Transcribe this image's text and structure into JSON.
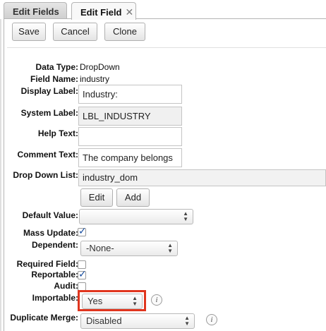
{
  "tabs": [
    {
      "label": "Edit Fields",
      "active": false
    },
    {
      "label": "Edit Field",
      "active": true,
      "close": "✕"
    }
  ],
  "toolbar": {
    "save_label": "Save",
    "cancel_label": "Cancel",
    "clone_label": "Clone"
  },
  "form": {
    "data_type": {
      "label": "Data Type:",
      "value": "DropDown"
    },
    "field_name": {
      "label": "Field Name:",
      "value": "industry"
    },
    "display_label": {
      "label": "Display Label:",
      "value": "Industry:"
    },
    "system_label": {
      "label": "System Label:",
      "value": "LBL_INDUSTRY"
    },
    "help_text": {
      "label": "Help Text:",
      "value": ""
    },
    "comment_text": {
      "label": "Comment Text:",
      "value": "The company belongs"
    },
    "drop_down_list": {
      "label": "Drop Down List:",
      "value": "industry_dom",
      "edit_label": "Edit",
      "add_label": "Add"
    },
    "default_value": {
      "label": "Default Value:",
      "value": ""
    },
    "mass_update": {
      "label": "Mass Update:",
      "checked": true
    },
    "dependent": {
      "label": "Dependent:",
      "value": "-None-"
    },
    "required_field": {
      "label": "Required Field:",
      "checked": false
    },
    "reportable": {
      "label": "Reportable:",
      "checked": true
    },
    "audit": {
      "label": "Audit:",
      "checked": false
    },
    "importable": {
      "label": "Importable:",
      "value": "Yes"
    },
    "duplicate_merge": {
      "label": "Duplicate Merge:",
      "value": "Disabled"
    }
  },
  "icons": {
    "check": "✓",
    "info": "i",
    "arrow_up": "▲",
    "arrow_down": "▼"
  },
  "colors": {
    "highlight": "#e0351e",
    "check": "#1a4fa0"
  }
}
